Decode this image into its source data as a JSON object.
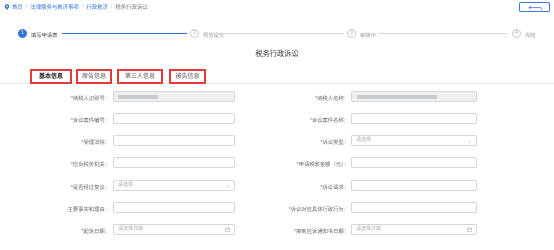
{
  "breadcrumb": {
    "home": "首页",
    "items": [
      "法律服务与救济事项",
      "行政救济",
      "税务行政诉讼"
    ],
    "back_label": "返回"
  },
  "steps": [
    {
      "num": "1",
      "label": "填写申请表",
      "active": true
    },
    {
      "num": "2",
      "label": "预览提交",
      "active": false
    },
    {
      "num": "3",
      "label": "审核中",
      "active": false
    },
    {
      "num": "4",
      "label": "完结",
      "active": false
    }
  ],
  "form_title": "税务行政诉讼",
  "tabs": [
    "基本信息",
    "原告信息",
    "第三人信息",
    "被告信息"
  ],
  "fields": {
    "taxpayer_id": {
      "label": "纳税人识别号",
      "required": true,
      "value": ""
    },
    "taxpayer_name": {
      "label": "纳税人名称",
      "required": true,
      "value": ""
    },
    "case_number": {
      "label": "诉讼案件编号",
      "required": true,
      "value": ""
    },
    "case_name": {
      "label": "诉讼案件名称",
      "required": true,
      "value": ""
    },
    "court": {
      "label": "受理法院",
      "required": true,
      "value": ""
    },
    "lawsuit_type": {
      "label": "诉讼类型",
      "required": true,
      "placeholder": "请选择"
    },
    "tax_office": {
      "label": "应诉税务机关",
      "required": true,
      "value": ""
    },
    "amount": {
      "label": "申请税收金额（元）",
      "required": true,
      "value": ""
    },
    "reconsideration": {
      "label": "是否经过复议",
      "required": true,
      "placeholder": "请选择"
    },
    "claims": {
      "label": "诉讼请求",
      "required": true,
      "value": ""
    },
    "facts": {
      "label": "主要事实和理由",
      "required": false,
      "value": ""
    },
    "specific_act": {
      "label": "诉讼对应具体行政行为",
      "required": true,
      "value": ""
    },
    "filing_date": {
      "label": "起诉日期",
      "required": true,
      "placeholder": "请选择日期"
    },
    "notice_date": {
      "label": "接到应诉通知书日期",
      "required": true,
      "placeholder": "请选择日期"
    }
  },
  "colors": {
    "accent": "#2f74d8",
    "highlight": "#e23b3b"
  }
}
